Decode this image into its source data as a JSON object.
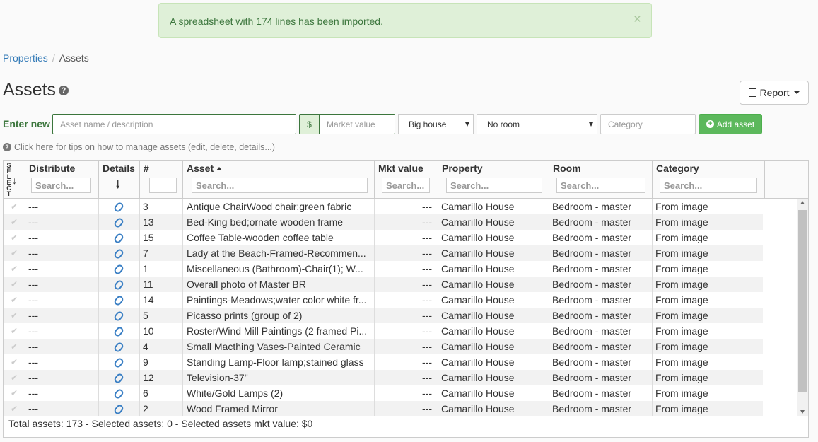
{
  "alert": {
    "message": "A spreadsheet with 174 lines has been imported.",
    "close": "×"
  },
  "breadcrumb": {
    "items": [
      "Properties",
      "Assets"
    ]
  },
  "page": {
    "title": "Assets",
    "help": "?"
  },
  "report_button": {
    "label": "Report"
  },
  "new_asset": {
    "label": "Enter new",
    "name_placeholder": "Asset name / description",
    "currency": "$",
    "value_placeholder": "Market value",
    "property_selected": "Big house",
    "room_selected": "No room",
    "category_placeholder": "Category",
    "add_label": "Add asset"
  },
  "tips": {
    "text": "Click here for tips on how to manage assets (edit, delete, details...)"
  },
  "table": {
    "headers": {
      "select": "SELECT",
      "distribute": "Distribute",
      "details": "Details",
      "number": "#",
      "asset": "Asset",
      "mkt_value": "Mkt value",
      "property": "Property",
      "room": "Room",
      "category": "Category"
    },
    "search_placeholder": "Search...",
    "rows": [
      {
        "distribute": "---",
        "num": "3",
        "asset": "Antique ChairWood chair;green fabric",
        "value": "---",
        "property": "Camarillo House",
        "room": "Bedroom - master",
        "category": "From image"
      },
      {
        "distribute": "---",
        "num": "13",
        "asset": "Bed-King bed;ornate wooden frame",
        "value": "---",
        "property": "Camarillo House",
        "room": "Bedroom - master",
        "category": "From image"
      },
      {
        "distribute": "---",
        "num": "15",
        "asset": "Coffee Table-wooden coffee table",
        "value": "---",
        "property": "Camarillo House",
        "room": "Bedroom - master",
        "category": "From image"
      },
      {
        "distribute": "---",
        "num": "7",
        "asset": "Lady at the Beach-Framed-Recommen...",
        "value": "---",
        "property": "Camarillo House",
        "room": "Bedroom - master",
        "category": "From image"
      },
      {
        "distribute": "---",
        "num": "1",
        "asset": "Miscellaneous (Bathroom)-Chair(1); W...",
        "value": "---",
        "property": "Camarillo House",
        "room": "Bedroom - master",
        "category": "From image"
      },
      {
        "distribute": "---",
        "num": "11",
        "asset": "Overall photo of Master BR",
        "value": "---",
        "property": "Camarillo House",
        "room": "Bedroom - master",
        "category": "From image"
      },
      {
        "distribute": "---",
        "num": "14",
        "asset": "Paintings-Meadows;water color white fr...",
        "value": "---",
        "property": "Camarillo House",
        "room": "Bedroom - master",
        "category": "From image"
      },
      {
        "distribute": "---",
        "num": "5",
        "asset": "Picasso prints (group of 2)",
        "value": "---",
        "property": "Camarillo House",
        "room": "Bedroom - master",
        "category": "From image"
      },
      {
        "distribute": "---",
        "num": "10",
        "asset": "Roster/Wind Mill Paintings (2 framed Pi...",
        "value": "---",
        "property": "Camarillo House",
        "room": "Bedroom - master",
        "category": "From image"
      },
      {
        "distribute": "---",
        "num": "4",
        "asset": "Small Macthing Vases-Painted Ceramic",
        "value": "---",
        "property": "Camarillo House",
        "room": "Bedroom - master",
        "category": "From image"
      },
      {
        "distribute": "---",
        "num": "9",
        "asset": "Standing Lamp-Floor lamp;stained glass",
        "value": "---",
        "property": "Camarillo House",
        "room": "Bedroom - master",
        "category": "From image"
      },
      {
        "distribute": "---",
        "num": "12",
        "asset": "Television-37\"",
        "value": "---",
        "property": "Camarillo House",
        "room": "Bedroom - master",
        "category": "From image"
      },
      {
        "distribute": "---",
        "num": "6",
        "asset": "White/Gold Lamps (2)",
        "value": "---",
        "property": "Camarillo House",
        "room": "Bedroom - master",
        "category": "From image"
      },
      {
        "distribute": "---",
        "num": "2",
        "asset": "Wood Framed Mirror",
        "value": "---",
        "property": "Camarillo House",
        "room": "Bedroom - master",
        "category": "From image"
      }
    ],
    "footer": "Total assets: 173 - Selected assets: 0 - Selected assets mkt value: $0"
  },
  "colors": {
    "accent": "#337ab7",
    "success": "#5cb85c",
    "success_text": "#3c763d",
    "alert_bg": "#dff0d8"
  }
}
